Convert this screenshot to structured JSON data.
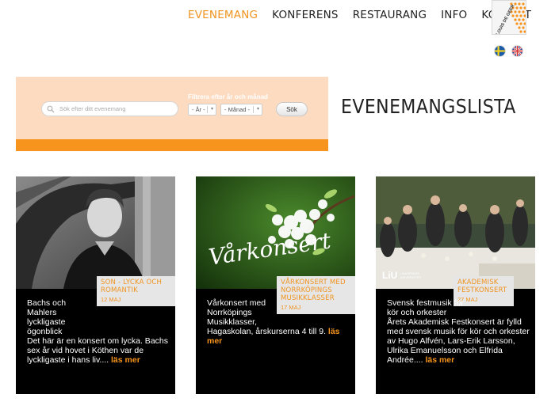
{
  "nav": {
    "items": [
      {
        "label": "EVENEMANG",
        "active": true
      },
      {
        "label": "KONFERENS",
        "active": false
      },
      {
        "label": "RESTAURANG",
        "active": false
      },
      {
        "label": "INFO",
        "active": false
      },
      {
        "label": "KONTAKT",
        "active": false
      }
    ]
  },
  "logo": {
    "text": "LOUIS DE GEER"
  },
  "languages": [
    {
      "name": "svenska",
      "icon": "sweden-flag-icon"
    },
    {
      "name": "english",
      "icon": "uk-flag-icon"
    }
  ],
  "search": {
    "placeholder": "Sök efter ditt evenemang",
    "filter_label": "Filtrera efter år och månad",
    "year_select": "- År -",
    "month_select": "- Månad -",
    "button_label": "Sök"
  },
  "page_title": "EVENEMANGSLISTA",
  "events": [
    {
      "tag_title": "SON - LYCKA OCH ROMANTIK",
      "date": "12 MAJ",
      "title": "Bachs och Mahlers lyckligaste ögonblick",
      "description": "Det här är en konsert om lycka. Bachs sex år vid hovet i Köthen var de lyckligaste i hans liv....",
      "read_more": "läs mer"
    },
    {
      "tag_title": "VÅRKONSERT MED NORRKÖPINGS MUSIKKLASSER",
      "date": "17 MAJ",
      "title": "Vårkonsert med Norrköpings Musikklasser,",
      "description": "Hagaskolan, årskurserna 4 till 9.",
      "read_more": "läs mer",
      "image_caption": "Vårkonsert"
    },
    {
      "tag_title": "AKADEMISK FESTKONSERT",
      "date": "27 MAJ",
      "title": "Svensk festmusik för kör och orkester",
      "description": "Årets Akademisk Festkonsert är fylld med svensk musik för kör och orkester av Hugo Alfvén, Lars-Erik Larsson, Ulrika Emanuelsson och Elfrida Andrée....",
      "read_more": "läs mer",
      "image_logo": "LiU",
      "image_logo_sub": "LINKÖPINGS UNIVERSITET"
    }
  ],
  "colors": {
    "accent": "#f0931f",
    "panel": "#fddbc1",
    "card_bg": "#000000",
    "tag_bg": "#e6e6e6"
  }
}
